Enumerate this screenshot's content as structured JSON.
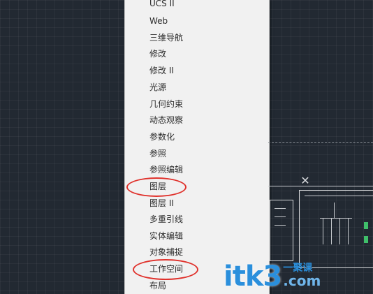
{
  "menu": {
    "items": [
      {
        "label": "UCS II",
        "circled": false
      },
      {
        "label": "Web",
        "circled": false
      },
      {
        "label": "三维导航",
        "circled": false
      },
      {
        "label": "修改",
        "circled": false
      },
      {
        "label": "修改 II",
        "circled": false
      },
      {
        "label": "光源",
        "circled": false
      },
      {
        "label": "几何约束",
        "circled": false
      },
      {
        "label": "动态观察",
        "circled": false
      },
      {
        "label": "参数化",
        "circled": false
      },
      {
        "label": "参照",
        "circled": false
      },
      {
        "label": "参照编辑",
        "circled": false
      },
      {
        "label": "图层",
        "circled": true
      },
      {
        "label": "图层 II",
        "circled": false
      },
      {
        "label": "多重引线",
        "circled": false
      },
      {
        "label": "实体编辑",
        "circled": false
      },
      {
        "label": "对象捕捉",
        "circled": false
      },
      {
        "label": "工作空间",
        "circled": true
      },
      {
        "label": "布局",
        "circled": false
      }
    ]
  },
  "drawing_close_icon": "close-x-icon",
  "colors": {
    "canvas_bg": "#222932",
    "menu_bg": "#f1f1f1",
    "highlight": "#e0322c",
    "watermark": "#2a8fdc"
  },
  "watermark": {
    "logo": "itk3",
    "cn": "一聚课",
    "domain": ".com"
  }
}
